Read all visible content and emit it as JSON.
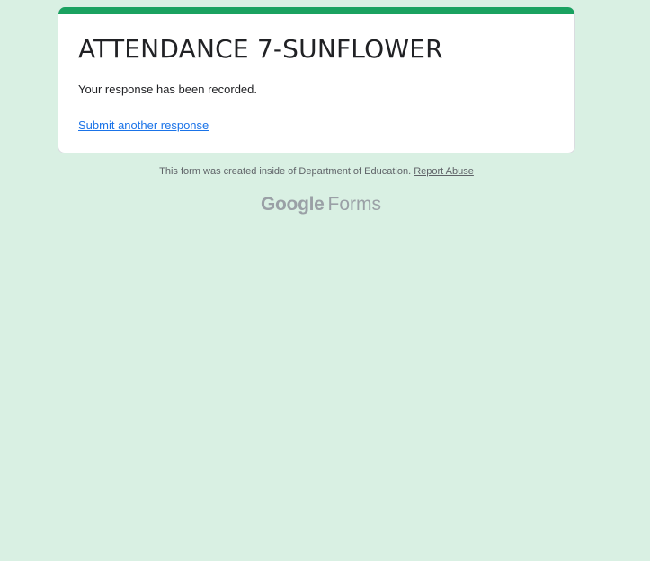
{
  "form": {
    "title": "ATTENDANCE 7-SUNFLOWER",
    "confirmation": "Your response has been recorded.",
    "submit_another": "Submit another response"
  },
  "footer": {
    "created_text": "This form was created inside of Department of Education.",
    "report_abuse": "Report Abuse"
  },
  "brand": {
    "google": "Google",
    "forms": "Forms"
  },
  "colors": {
    "background": "#d9f0e3",
    "accent": "#1aa260",
    "link": "#1a73e8"
  }
}
